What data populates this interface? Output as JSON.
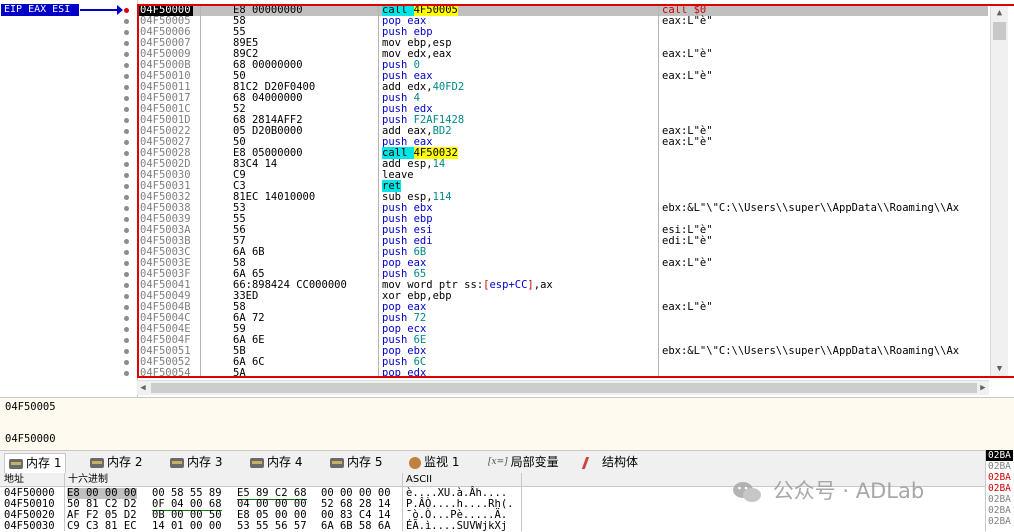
{
  "eip_label": "EIP EAX ESI",
  "disasm": [
    {
      "addr": "04F50000",
      "bytes": "E8 00000000",
      "ins": [
        {
          "t": "call ",
          "c": "hl-call"
        },
        {
          "t": "4F50005",
          "c": "op-yellow"
        }
      ],
      "cmt": "call $0",
      "current": true,
      "dot": "red"
    },
    {
      "addr": "04F50005",
      "bytes": "58",
      "ins": [
        {
          "t": "pop ",
          "c": "mn-blue"
        },
        {
          "t": "eax",
          "c": "op-blue"
        }
      ],
      "cmt": "eax:L\"è\""
    },
    {
      "addr": "04F50006",
      "bytes": "55",
      "ins": [
        {
          "t": "push ",
          "c": "mn-blue"
        },
        {
          "t": "ebp",
          "c": "op-blue"
        }
      ],
      "cmt": ""
    },
    {
      "addr": "04F50007",
      "bytes": "89E5",
      "ins": [
        {
          "t": "mov ebp,esp",
          "c": "mn-black"
        }
      ],
      "cmt": ""
    },
    {
      "addr": "04F50009",
      "bytes": "89C2",
      "ins": [
        {
          "t": "mov edx,eax",
          "c": "mn-black"
        }
      ],
      "cmt": "eax:L\"è\""
    },
    {
      "addr": "04F5000B",
      "bytes": "68 00000000",
      "ins": [
        {
          "t": "push ",
          "c": "mn-blue"
        },
        {
          "t": "0",
          "c": "op-cyan"
        }
      ],
      "cmt": ""
    },
    {
      "addr": "04F50010",
      "bytes": "50",
      "ins": [
        {
          "t": "push ",
          "c": "mn-blue"
        },
        {
          "t": "eax",
          "c": "op-blue"
        }
      ],
      "cmt": "eax:L\"è\""
    },
    {
      "addr": "04F50011",
      "bytes": "81C2 D20F0400",
      "ins": [
        {
          "t": "add edx,",
          "c": "mn-black"
        },
        {
          "t": "40FD2",
          "c": "op-cyan"
        }
      ],
      "cmt": ""
    },
    {
      "addr": "04F50017",
      "bytes": "68 04000000",
      "ins": [
        {
          "t": "push ",
          "c": "mn-blue"
        },
        {
          "t": "4",
          "c": "op-cyan"
        }
      ],
      "cmt": ""
    },
    {
      "addr": "04F5001C",
      "bytes": "52",
      "ins": [
        {
          "t": "push ",
          "c": "mn-blue"
        },
        {
          "t": "edx",
          "c": "op-blue"
        }
      ],
      "cmt": ""
    },
    {
      "addr": "04F5001D",
      "bytes": "68 2814AFF2",
      "ins": [
        {
          "t": "push ",
          "c": "mn-blue"
        },
        {
          "t": "F2AF1428",
          "c": "op-cyan"
        }
      ],
      "cmt": ""
    },
    {
      "addr": "04F50022",
      "bytes": "05 D20B0000",
      "ins": [
        {
          "t": "add eax,",
          "c": "mn-black"
        },
        {
          "t": "BD2",
          "c": "op-cyan"
        }
      ],
      "cmt": "eax:L\"è\""
    },
    {
      "addr": "04F50027",
      "bytes": "50",
      "ins": [
        {
          "t": "push ",
          "c": "mn-blue"
        },
        {
          "t": "eax",
          "c": "op-blue"
        }
      ],
      "cmt": "eax:L\"è\""
    },
    {
      "addr": "04F50028",
      "bytes": "E8 05000000",
      "ins": [
        {
          "t": "call ",
          "c": "hl-call"
        },
        {
          "t": "4F50032",
          "c": "op-yellow"
        }
      ],
      "cmt": ""
    },
    {
      "addr": "04F5002D",
      "bytes": "83C4 14",
      "ins": [
        {
          "t": "add esp,",
          "c": "mn-black"
        },
        {
          "t": "14",
          "c": "op-cyan"
        }
      ],
      "cmt": ""
    },
    {
      "addr": "04F50030",
      "bytes": "C9",
      "ins": [
        {
          "t": "leave",
          "c": "mn-black"
        }
      ],
      "cmt": ""
    },
    {
      "addr": "04F50031",
      "bytes": "C3",
      "ins": [
        {
          "t": "ret",
          "c": "hl-ret"
        }
      ],
      "cmt": ""
    },
    {
      "addr": "04F50032",
      "bytes": "81EC 14010000",
      "ins": [
        {
          "t": "sub esp,",
          "c": "mn-black"
        },
        {
          "t": "114",
          "c": "op-cyan"
        }
      ],
      "cmt": ""
    },
    {
      "addr": "04F50038",
      "bytes": "53",
      "ins": [
        {
          "t": "push ",
          "c": "mn-blue"
        },
        {
          "t": "ebx",
          "c": "op-blue"
        }
      ],
      "cmt": "ebx:&L\"\\\"C:\\\\Users\\\\super\\\\AppData\\\\Roaming\\\\Ax"
    },
    {
      "addr": "04F50039",
      "bytes": "55",
      "ins": [
        {
          "t": "push ",
          "c": "mn-blue"
        },
        {
          "t": "ebp",
          "c": "op-blue"
        }
      ],
      "cmt": ""
    },
    {
      "addr": "04F5003A",
      "bytes": "56",
      "ins": [
        {
          "t": "push ",
          "c": "mn-blue"
        },
        {
          "t": "esi",
          "c": "op-blue"
        }
      ],
      "cmt": "esi:L\"è\""
    },
    {
      "addr": "04F5003B",
      "bytes": "57",
      "ins": [
        {
          "t": "push ",
          "c": "mn-blue"
        },
        {
          "t": "edi",
          "c": "op-blue"
        }
      ],
      "cmt": "edi:L\"è\""
    },
    {
      "addr": "04F5003C",
      "bytes": "6A 6B",
      "ins": [
        {
          "t": "push ",
          "c": "mn-blue"
        },
        {
          "t": "6B",
          "c": "op-cyan"
        }
      ],
      "cmt": ""
    },
    {
      "addr": "04F5003E",
      "bytes": "58",
      "ins": [
        {
          "t": "pop ",
          "c": "mn-blue"
        },
        {
          "t": "eax",
          "c": "op-blue"
        }
      ],
      "cmt": "eax:L\"è\""
    },
    {
      "addr": "04F5003F",
      "bytes": "6A 65",
      "ins": [
        {
          "t": "push ",
          "c": "mn-blue"
        },
        {
          "t": "65",
          "c": "op-cyan"
        }
      ],
      "cmt": ""
    },
    {
      "addr": "04F50041",
      "bytes": "66:898424 CC000000",
      "ins": [
        {
          "t": "mov word ptr ss:",
          "c": "mn-black"
        },
        {
          "t": "[",
          "c": "op-red"
        },
        {
          "t": "esp+CC",
          "c": "op-blue"
        },
        {
          "t": "]",
          "c": "op-red"
        },
        {
          "t": ",ax",
          "c": "mn-black"
        }
      ],
      "cmt": ""
    },
    {
      "addr": "04F50049",
      "bytes": "33ED",
      "ins": [
        {
          "t": "xor ebp,ebp",
          "c": "mn-black"
        }
      ],
      "cmt": ""
    },
    {
      "addr": "04F5004B",
      "bytes": "58",
      "ins": [
        {
          "t": "pop ",
          "c": "mn-blue"
        },
        {
          "t": "eax",
          "c": "op-blue"
        }
      ],
      "cmt": "eax:L\"è\""
    },
    {
      "addr": "04F5004C",
      "bytes": "6A 72",
      "ins": [
        {
          "t": "push ",
          "c": "mn-blue"
        },
        {
          "t": "72",
          "c": "op-cyan"
        }
      ],
      "cmt": ""
    },
    {
      "addr": "04F5004E",
      "bytes": "59",
      "ins": [
        {
          "t": "pop ",
          "c": "mn-blue"
        },
        {
          "t": "ecx",
          "c": "op-blue"
        }
      ],
      "cmt": ""
    },
    {
      "addr": "04F5004F",
      "bytes": "6A 6E",
      "ins": [
        {
          "t": "push ",
          "c": "mn-blue"
        },
        {
          "t": "6E",
          "c": "op-cyan"
        }
      ],
      "cmt": ""
    },
    {
      "addr": "04F50051",
      "bytes": "5B",
      "ins": [
        {
          "t": "pop ",
          "c": "mn-blue"
        },
        {
          "t": "ebx",
          "c": "op-blue"
        }
      ],
      "cmt": "ebx:&L\"\\\"C:\\\\Users\\\\super\\\\AppData\\\\Roaming\\\\Ax"
    },
    {
      "addr": "04F50052",
      "bytes": "6A 6C",
      "ins": [
        {
          "t": "push ",
          "c": "mn-blue"
        },
        {
          "t": "6C",
          "c": "op-cyan"
        }
      ],
      "cmt": ""
    },
    {
      "addr": "04F50054",
      "bytes": "5A",
      "ins": [
        {
          "t": "pop ",
          "c": "mn-blue"
        },
        {
          "t": "edx",
          "c": "op-blue"
        }
      ],
      "cmt": ""
    }
  ],
  "info": {
    "line1": "04F50005",
    "line2": "04F50000"
  },
  "tabs": [
    {
      "label": "内存 1",
      "icon": "memory-icon",
      "active": true
    },
    {
      "label": "内存 2",
      "icon": "memory-icon"
    },
    {
      "label": "内存 3",
      "icon": "memory-icon"
    },
    {
      "label": "内存 4",
      "icon": "memory-icon"
    },
    {
      "label": "内存 5",
      "icon": "memory-icon"
    },
    {
      "label": "监视 1",
      "icon": "watch-icon"
    },
    {
      "label": "局部变量",
      "icon": "locals-icon",
      "prefix": "[x=]"
    },
    {
      "label": "结构体",
      "icon": "struct-icon"
    }
  ],
  "dump": {
    "headers": {
      "addr": "地址",
      "hex": "十六进制",
      "ascii": "ASCII"
    },
    "rows": [
      {
        "addr": "04F50000",
        "g": [
          "E8 00 00 00",
          "00 58 55 89",
          "E5 89 C2 68",
          "00 00 00 00"
        ],
        "ascii": "è....XU.à.Âh...."
      },
      {
        "addr": "04F50010",
        "g": [
          "50 81 C2 D2",
          "0F 04 00 68",
          "04 00 00 00",
          "52 68 28 14"
        ],
        "ascii": "P.ÂÒ....h....Rh(."
      },
      {
        "addr": "04F50020",
        "g": [
          "AF F2 05 D2",
          "0B 00 00 50",
          "E8 05 00 00",
          "00 83 C4 14"
        ],
        "ascii": "¯ò.Ò...Pè.....Ä."
      },
      {
        "addr": "04F50030",
        "g": [
          "C9 C3 81 EC",
          "14 01 00 00",
          "53 55 56 57",
          "6A 6B 58 6A"
        ],
        "ascii": "ÉÃ.ì....SUVWjkXj"
      }
    ]
  },
  "mini": [
    "02BA",
    "02BA",
    "02BA",
    "02BA",
    "02BA",
    "02BA",
    "02BA"
  ],
  "watermark": "公众号 · ADLab"
}
